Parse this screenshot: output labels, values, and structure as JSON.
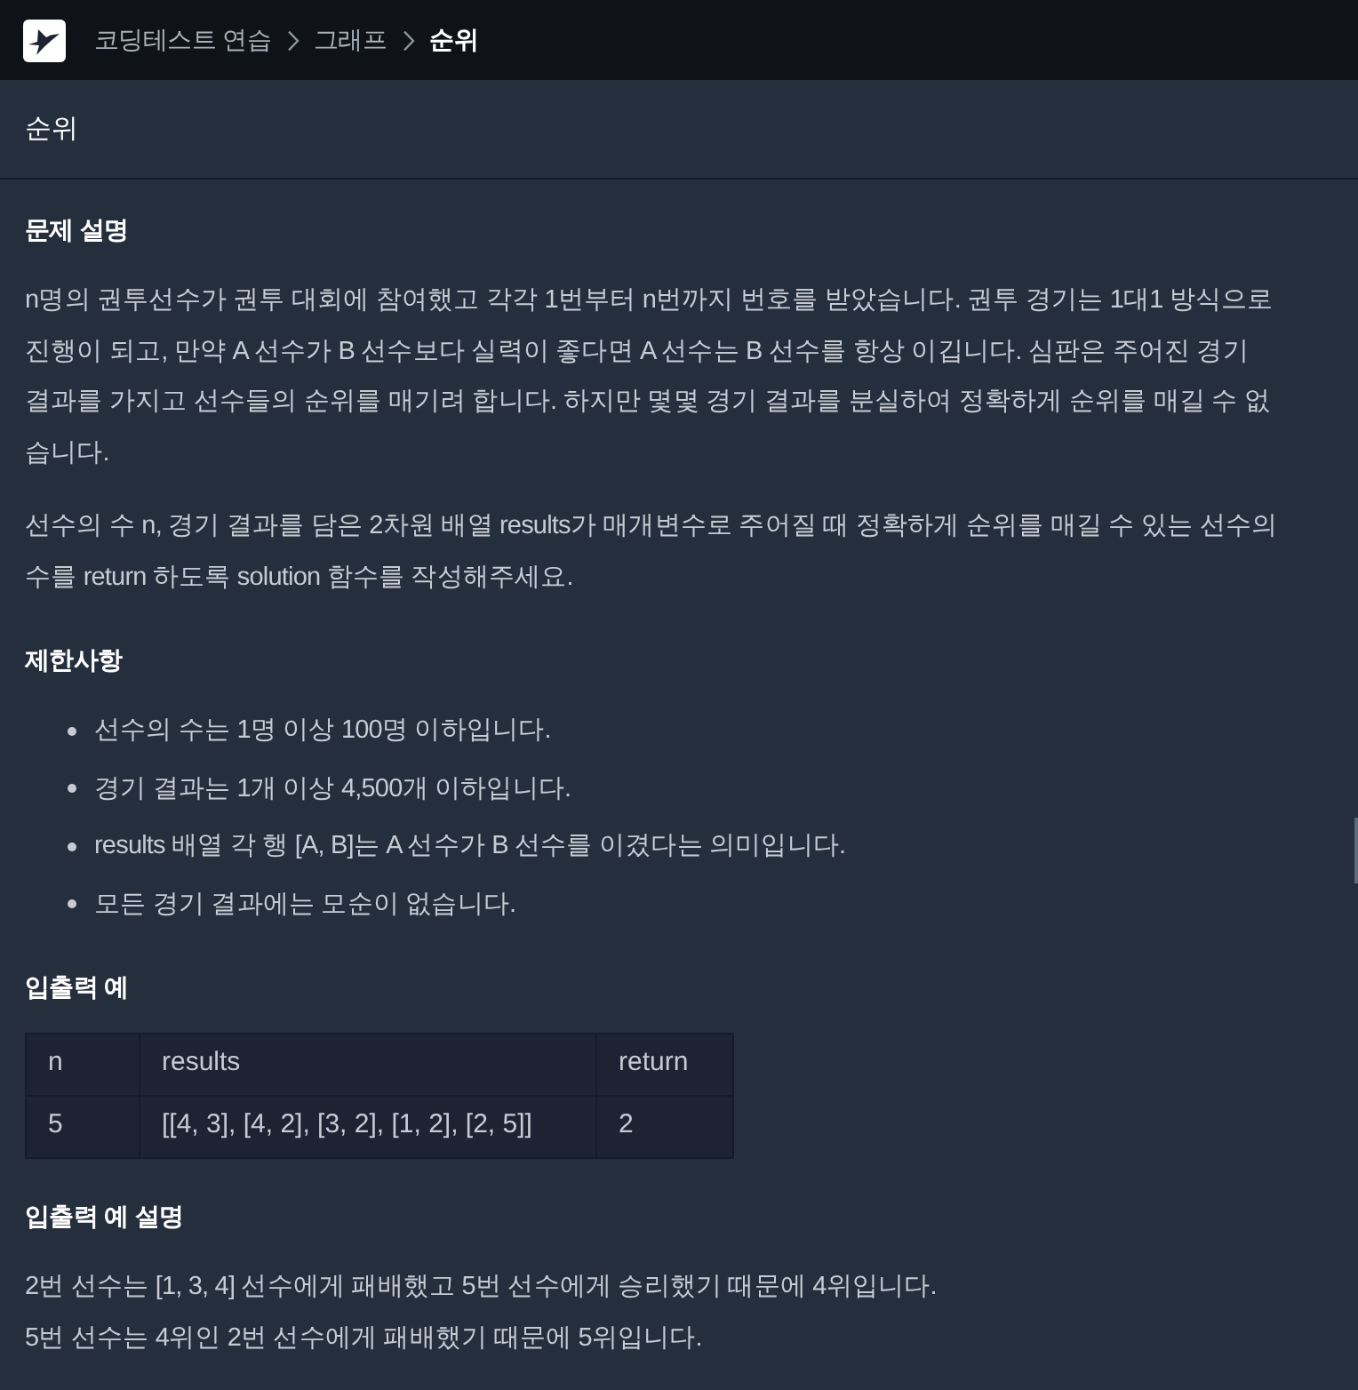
{
  "header": {
    "breadcrumb": [
      {
        "label": "코딩테스트 연습",
        "selected": false
      },
      {
        "label": "그래프",
        "selected": false
      },
      {
        "label": "순위",
        "selected": true
      }
    ]
  },
  "title": "순위",
  "sections": [
    {
      "heading": "문제 설명",
      "blocks": [
        {
          "kind": "paragraph",
          "text": "n명의 권투선수가 권투 대회에 참여했고 각각 1번부터 n번까지 번호를 받았습니다. 권투 경기는 1대1 방식으로 진행이 되고, 만약 A 선수가 B 선수보다 실력이 좋다면 A 선수는 B 선수를 항상 이깁니다. 심판은 주어진 경기 결과를 가지고 선수들의 순위를 매기려 합니다. 하지만 몇몇 경기 결과를 분실하여 정확하게 순위를 매길 수 없습니다."
        },
        {
          "kind": "paragraph",
          "text": "선수의 수 n, 경기 결과를 담은 2차원 배열 results가 매개변수로 주어질 때 정확하게 순위를 매길 수 있는 선수의 수를 return 하도록 solution 함수를 작성해주세요."
        }
      ]
    },
    {
      "heading": "제한사항",
      "blocks": [
        {
          "kind": "list",
          "items": [
            "선수의 수는 1명 이상 100명 이하입니다.",
            "경기 결과는 1개 이상 4,500개 이하입니다.",
            "results 배열 각 행 [A, B]는 A 선수가 B 선수를 이겼다는 의미입니다.",
            "모든 경기 결과에는 모순이 없습니다."
          ]
        }
      ]
    },
    {
      "heading": "입출력 예",
      "blocks": [
        {
          "kind": "table",
          "columns": [
            "n",
            "results",
            "return"
          ],
          "rows": [
            [
              "5",
              "[[4, 3], [4, 2], [3, 2], [1, 2], [2, 5]]",
              "2"
            ]
          ]
        }
      ]
    },
    {
      "heading": "입출력 예 설명",
      "blocks": [
        {
          "kind": "lines",
          "items": [
            "2번 선수는 [1, 3, 4] 선수에게 패배했고 5번 선수에게 승리했기 때문에 4위입니다.",
            "5번 선수는 4위인 2번 선수에게 패배했기 때문에 5위입니다."
          ]
        }
      ]
    }
  ]
}
